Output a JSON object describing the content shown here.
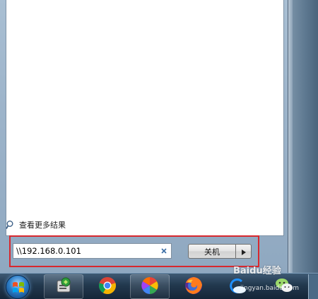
{
  "start_menu": {
    "more_results_label": "查看更多结果",
    "search": {
      "value": "\\\\192.168.0.101",
      "clear_glyph": "×"
    },
    "shutdown": {
      "label": "关机",
      "arrow_glyph": "▸"
    }
  },
  "taskbar": {
    "items": [
      {
        "icon": "windows-start-orb-icon"
      },
      {
        "icon": "app-green-icon"
      },
      {
        "icon": "chrome-icon"
      },
      {
        "icon": "pinwheel-photos-icon"
      },
      {
        "icon": "firefox-icon"
      },
      {
        "icon": "cloud-sync-icon"
      },
      {
        "icon": "wechat-icon"
      }
    ]
  },
  "watermark": {
    "text": "Baidu经验",
    "sub": "jingyan.baidu.com"
  },
  "colors": {
    "highlight": "#d8282e",
    "taskbar": "#22384e"
  }
}
